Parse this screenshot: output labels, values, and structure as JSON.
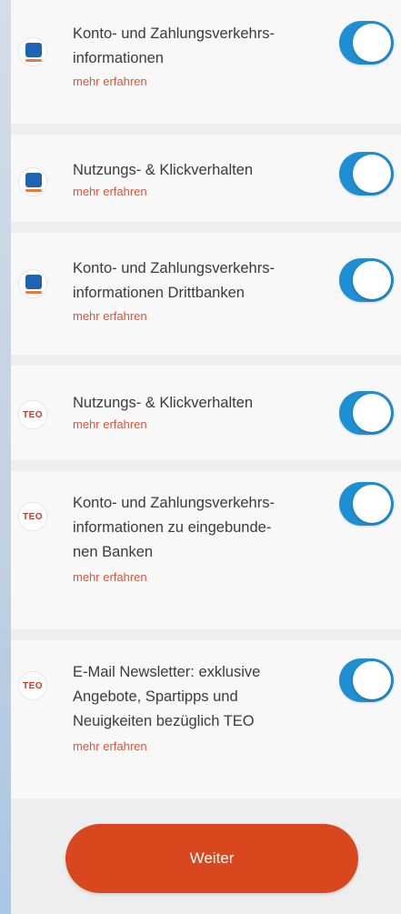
{
  "consents": [
    {
      "logo": "bank-logo-icon",
      "title": "Konto- und Zahlungsverkehrs-informationen",
      "lines": [
        "Konto- und Zahlungsverkehrs-",
        "informationen"
      ],
      "link": "mehr erfahren",
      "enabled": true
    },
    {
      "logo": "bank-logo-icon",
      "title": "Nutzungs- & Klickverhalten",
      "lines": [
        "Nutzungs- & Klickverhalten"
      ],
      "link": "mehr erfahren",
      "enabled": true
    },
    {
      "logo": "bank-logo-icon",
      "title": "Konto- und Zahlungsverkehrs-informationen Drittbanken",
      "lines": [
        "Konto- und Zahlungsverkehrs-",
        "informationen Drittbanken"
      ],
      "link": "mehr erfahren",
      "enabled": true
    },
    {
      "logo": "teo-logo-icon",
      "logo_text": "TEO",
      "title": "Nutzungs- & Klickverhalten",
      "lines": [
        "Nutzungs- & Klickverhalten"
      ],
      "link": "mehr erfahren",
      "enabled": true
    },
    {
      "logo": "teo-logo-icon",
      "logo_text": "TEO",
      "title": "Konto- und Zahlungsverkehrs-informationen zu eingebunde-nen Banken",
      "lines": [
        "Konto- und Zahlungsverkehrs-",
        "informationen zu eingebunde-",
        "nen Banken"
      ],
      "link": "mehr erfahren",
      "enabled": true
    },
    {
      "logo": "teo-logo-icon",
      "logo_text": "TEO",
      "title": "E-Mail Newsletter: exklusive Angebote, Spartipps und Neuigkeiten bezüglich TEO",
      "lines": [
        "E-Mail Newsletter: exklusive",
        "Angebote, Spartipps und",
        "Neuigkeiten bezüglich TEO"
      ],
      "link": "mehr erfahren",
      "enabled": true
    }
  ],
  "button": {
    "label": "Weiter"
  },
  "colors": {
    "toggle_on": "#1f8fd4",
    "link": "#d8563a",
    "button": "#d9471f",
    "card": "#f8f8f8",
    "separator": "#eeeeee",
    "bank_blue": "#1f64b4",
    "teo_red": "#c53a2b"
  }
}
